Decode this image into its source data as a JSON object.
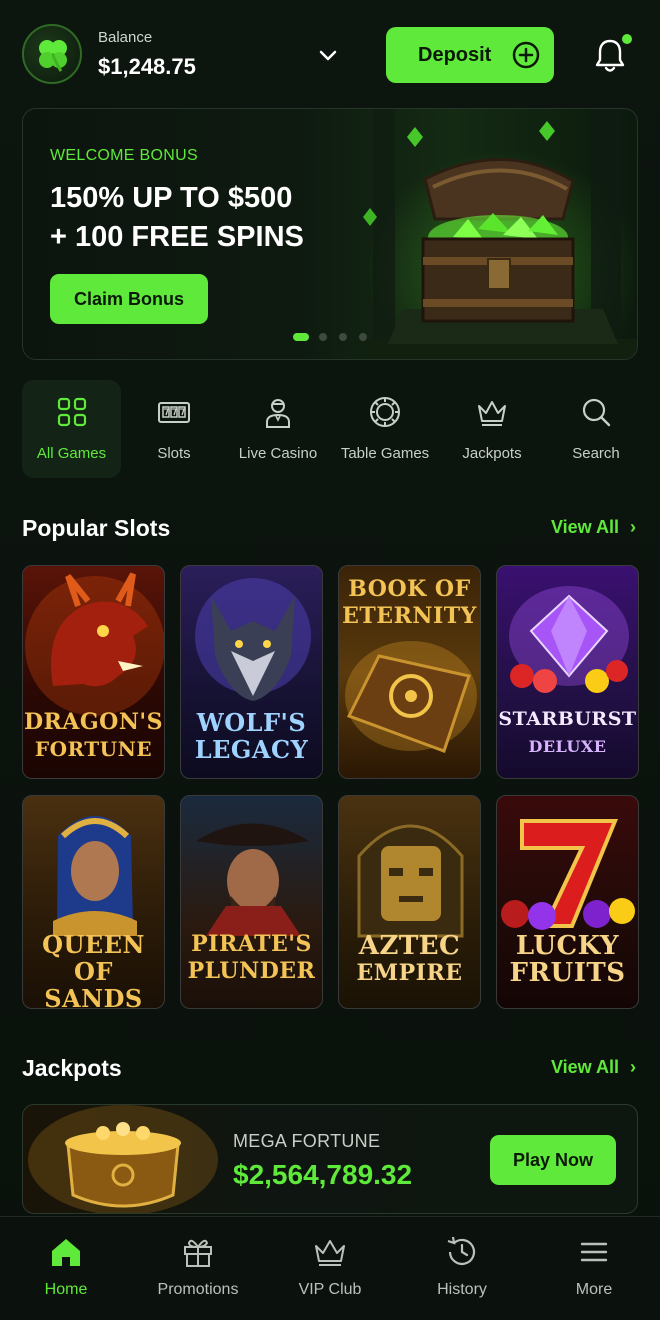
{
  "header": {
    "balance_label": "Balance",
    "balance_value": "$1,248.75",
    "deposit_label": "Deposit",
    "logo_icon": "clover-icon",
    "notification_icon": "bell-icon",
    "has_notification": true
  },
  "banner": {
    "tag": "WELCOME BONUS",
    "title_line1": "150% UP TO $500",
    "title_line2": "+ 100 FREE SPINS",
    "cta": "Claim Bonus",
    "slide_count": 4,
    "active_slide": 1
  },
  "categories": [
    {
      "label": "All Games",
      "icon": "grid-icon",
      "active": true
    },
    {
      "label": "Slots",
      "icon": "slot-machine-icon",
      "active": false
    },
    {
      "label": "Live Casino",
      "icon": "dealer-icon",
      "active": false
    },
    {
      "label": "Table Games",
      "icon": "chip-icon",
      "active": false
    },
    {
      "label": "Jackpots",
      "icon": "crown-icon",
      "active": false
    },
    {
      "label": "Search",
      "icon": "search-icon",
      "active": false
    }
  ],
  "popular": {
    "title": "Popular Slots",
    "view_all": "View All",
    "games": [
      {
        "line1": "DRAGON'S",
        "line2": "FORTUNE"
      },
      {
        "line1": "WOLF'S",
        "line2": "LEGACY"
      },
      {
        "line1": "BOOK OF",
        "line2": "ETERNITY"
      },
      {
        "line1": "STARBURST",
        "line2": "DELUXE"
      },
      {
        "line1": "QUEEN OF",
        "line2": "SANDS"
      },
      {
        "line1": "PIRATE'S",
        "line2": "PLUNDER"
      },
      {
        "line1": "AZTEC",
        "line2": "EMPIRE"
      },
      {
        "line1": "LUCKY",
        "line2": "FRUITS"
      }
    ]
  },
  "jackpots": {
    "title": "Jackpots",
    "view_all": "View All",
    "name": "MEGA FORTUNE",
    "amount": "$2,564,789.32",
    "cta": "Play Now"
  },
  "bottom_nav": [
    {
      "label": "Home",
      "icon": "home-icon",
      "active": true
    },
    {
      "label": "Promotions",
      "icon": "gift-icon",
      "active": false
    },
    {
      "label": "VIP Club",
      "icon": "crown-icon",
      "active": false
    },
    {
      "label": "History",
      "icon": "history-icon",
      "active": false
    },
    {
      "label": "More",
      "icon": "menu-icon",
      "active": false
    }
  ],
  "colors": {
    "accent": "#5fe93a",
    "background": "#0a120c"
  }
}
